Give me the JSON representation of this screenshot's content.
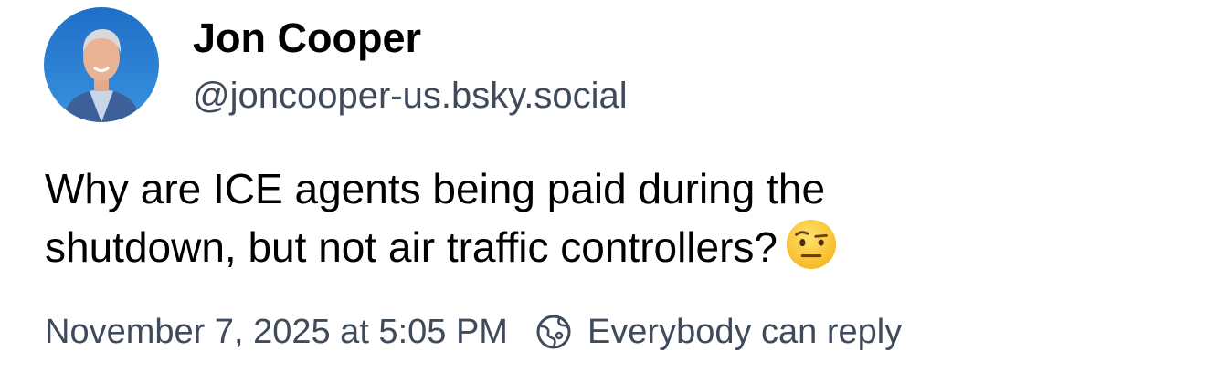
{
  "post": {
    "author": {
      "name": "Jon Cooper",
      "handle": "@joncooper-us.bsky.social",
      "avatar_icon": "profile-photo"
    },
    "text_lines": [
      "Why are ICE agents being paid during the",
      "shutdown, but not air traffic controllers?"
    ],
    "emoji": "raised-eyebrow-emoji",
    "timestamp": "November 7, 2025 at 5:05 PM",
    "reply_setting": {
      "label": "Everybody can reply",
      "icon": "globe-icon"
    }
  },
  "colors": {
    "text": "#000000",
    "muted": "#3f4a5b",
    "avatar_bg": "#2f7fd0"
  }
}
